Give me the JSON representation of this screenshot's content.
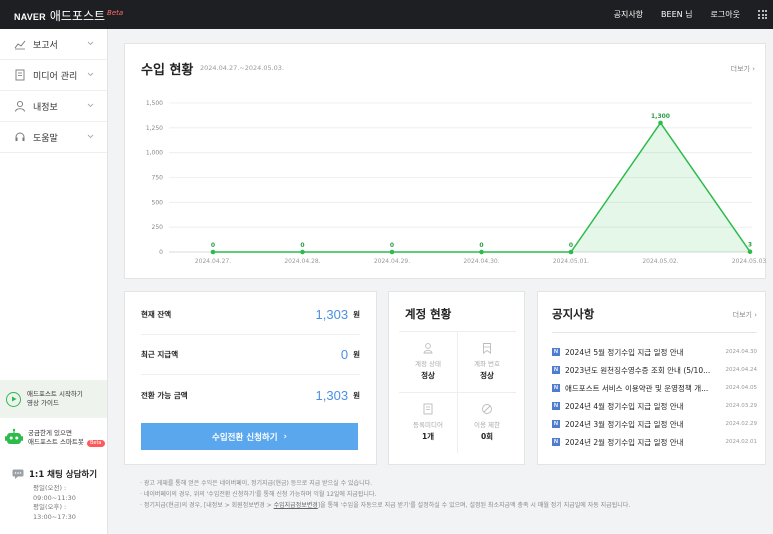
{
  "topbar": {
    "logo_naver": "NAVER",
    "brand": "애드포스트",
    "beta": "Beta",
    "links": [
      "공지사항",
      "BEEN 님",
      "로그아웃"
    ]
  },
  "sidebar": {
    "items": [
      {
        "label": "보고서",
        "icon": "chart-line-icon"
      },
      {
        "label": "미디어 관리",
        "icon": "document-icon"
      },
      {
        "label": "내정보",
        "icon": "person-icon"
      },
      {
        "label": "도움말",
        "icon": "headset-icon"
      }
    ],
    "guide": {
      "line1": "애드포스트 시작하기",
      "line2": "영상 가이드"
    },
    "chatbot": {
      "line1": "궁금한게 있으면",
      "line2": "애드포스트 스마트봇",
      "badge": "Beta"
    },
    "chat": {
      "title": "1:1 채팅 상담하기",
      "hours": [
        "평일(오전) :",
        "09:00~11:30",
        "평일(오후) :",
        "13:00~17:30"
      ]
    }
  },
  "income": {
    "title": "수입 현황",
    "date_range": "2024.04.27.~2024.05.03.",
    "more": "더보기"
  },
  "chart_data": {
    "type": "area",
    "categories": [
      "2024.04.27.",
      "2024.04.28.",
      "2024.04.29.",
      "2024.04.30.",
      "2024.05.01.",
      "2024.05.02.",
      "2024.05.03."
    ],
    "values": [
      0,
      0,
      0,
      0,
      0,
      1300,
      3
    ],
    "data_labels": [
      "0",
      "0",
      "0",
      "0",
      "0",
      "1,300",
      "3"
    ],
    "ylim": [
      0,
      1500
    ],
    "yticks": [
      0,
      250,
      500,
      750,
      1000,
      1250,
      1500
    ],
    "ytick_labels": [
      "0",
      "250",
      "500",
      "750",
      "1,000",
      "1,250",
      "1,500"
    ],
    "grid": true,
    "color": "#2dbb4c"
  },
  "balance": {
    "rows": [
      {
        "label": "현재 잔액",
        "value": "1,303",
        "unit": "원"
      },
      {
        "label": "최근 지급액",
        "value": "0",
        "unit": "원"
      },
      {
        "label": "전환 가능 금액",
        "value": "1,303",
        "unit": "원"
      }
    ],
    "button": "수입전환 신청하기"
  },
  "account": {
    "title": "계정 현황",
    "cells": [
      {
        "label": "계정 상태",
        "value": "정상",
        "icon": "person-outline-icon"
      },
      {
        "label": "계좌 번호",
        "value": "정상",
        "icon": "bookmark-icon"
      },
      {
        "label": "등록미디어",
        "value": "1개",
        "icon": "document-icon"
      },
      {
        "label": "이용 제한",
        "value": "0회",
        "icon": "ban-icon"
      }
    ]
  },
  "notice": {
    "title": "공지사항",
    "more": "더보기",
    "badge": "N",
    "items": [
      {
        "text": "2024년 5월 정기수입 지급 일정 안내",
        "date": "2024.04.30"
      },
      {
        "text": "2023년도 원천징수영수증 조회 안내 (5/10...",
        "date": "2024.04.24"
      },
      {
        "text": "애드포스트 서비스 이용약관 및 운영정책 개...",
        "date": "2024.04.05"
      },
      {
        "text": "2024년 4월 정기수입 지급 일정 안내",
        "date": "2024.03.29"
      },
      {
        "text": "2024년 3월 정기수입 지급 일정 안내",
        "date": "2024.02.29"
      },
      {
        "text": "2024년 2월 정기수입 지급 일정 안내",
        "date": "2024.02.01"
      }
    ]
  },
  "footnotes": [
    "광고 게재를 통해 얻은 수익은 네이버페이, 정기지급(현금) 등으로 지급 받으실 수 있습니다.",
    "네이버페이의 경우, 위의 '수입전환 신청하기'를 통해 신청 가능하며 익월 12일에 지급됩니다.",
    {
      "pre": "정기지급(현금)의 경우, [내정보 > 회원정보변경 > ",
      "link": "수입지급정보변경",
      "post": "]을 통해 '수입을 자동으로 지급 받기'를 설정하실 수 있으며, 설정된 최소지급액 충족 시 매월 정기 지급일에 자동 지급됩니다."
    }
  ]
}
